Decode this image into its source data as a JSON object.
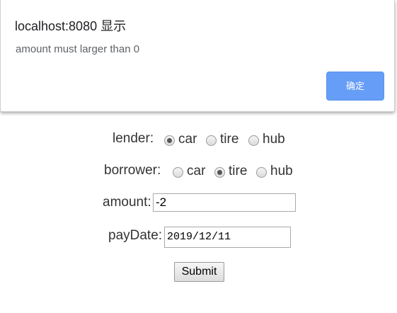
{
  "dialog": {
    "title": "localhost:8080 显示",
    "message": "amount must larger than 0",
    "ok_label": "确定"
  },
  "form": {
    "lender": {
      "label": "lender:",
      "options": [
        "car",
        "tire",
        "hub"
      ],
      "selected": "car"
    },
    "borrower": {
      "label": "borrower:",
      "options": [
        "car",
        "tire",
        "hub"
      ],
      "selected": "tire"
    },
    "amount": {
      "label": "amount:",
      "value": "-2"
    },
    "payDate": {
      "label": "payDate:",
      "value": "2019/12/11"
    },
    "submit_label": "Submit"
  },
  "colors": {
    "ok_button": "#669df6",
    "dialog_title": "#202124",
    "dialog_message": "#5f6368"
  }
}
